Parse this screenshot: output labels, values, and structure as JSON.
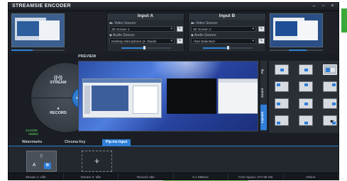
{
  "window": {
    "title": "STREAMSIE ENCODER",
    "controls": {
      "minimize": "–",
      "restore": "▫",
      "close": "×"
    }
  },
  "inputs": [
    {
      "header": "Input A",
      "video_source_label": "Video Source:",
      "video_source_value": "2D Screen 1",
      "audio_source_label": "Audio Source:",
      "audio_source_value": "Desktop Microphone (2- Studio",
      "volume": 0.45
    },
    {
      "header": "Input B",
      "video_source_label": "Video Source:",
      "video_source_value": "2D Screen 2",
      "audio_source_label": "Audio Source:",
      "audio_source_value": "<Not Selected>",
      "volume": 0.5
    }
  ],
  "preview": {
    "label": "PREVIEW"
  },
  "dial": {
    "stream_label": "STREAM",
    "stop_all_label": "STOP ALL",
    "record_label": "RECORD"
  },
  "brand": {
    "line1": "ZAZOIR",
    "line2": "VIDEO"
  },
  "side_tabs": [
    "Pip",
    "Sound",
    "Layouts"
  ],
  "active_side_tab": "Layouts",
  "bottom_tabs": [
    "Watermarks",
    "Chroma Key",
    "Pip-ins Input"
  ],
  "active_bottom_tab": "Pip-ins Input",
  "pip_card": {
    "tag_a": "A",
    "tag_b": "B",
    "icon": "⠿"
  },
  "add_card_label": "+",
  "status": [
    "Stream 1: Idle",
    "Stream 2: Idle",
    "Record: Idle",
    "0.1 MB/sec",
    "Free Space: 377.69 GB",
    "Online"
  ],
  "colors": {
    "accent": "#2f7fd8",
    "brand_green": "#4fae4f",
    "background": "#1d2127"
  }
}
